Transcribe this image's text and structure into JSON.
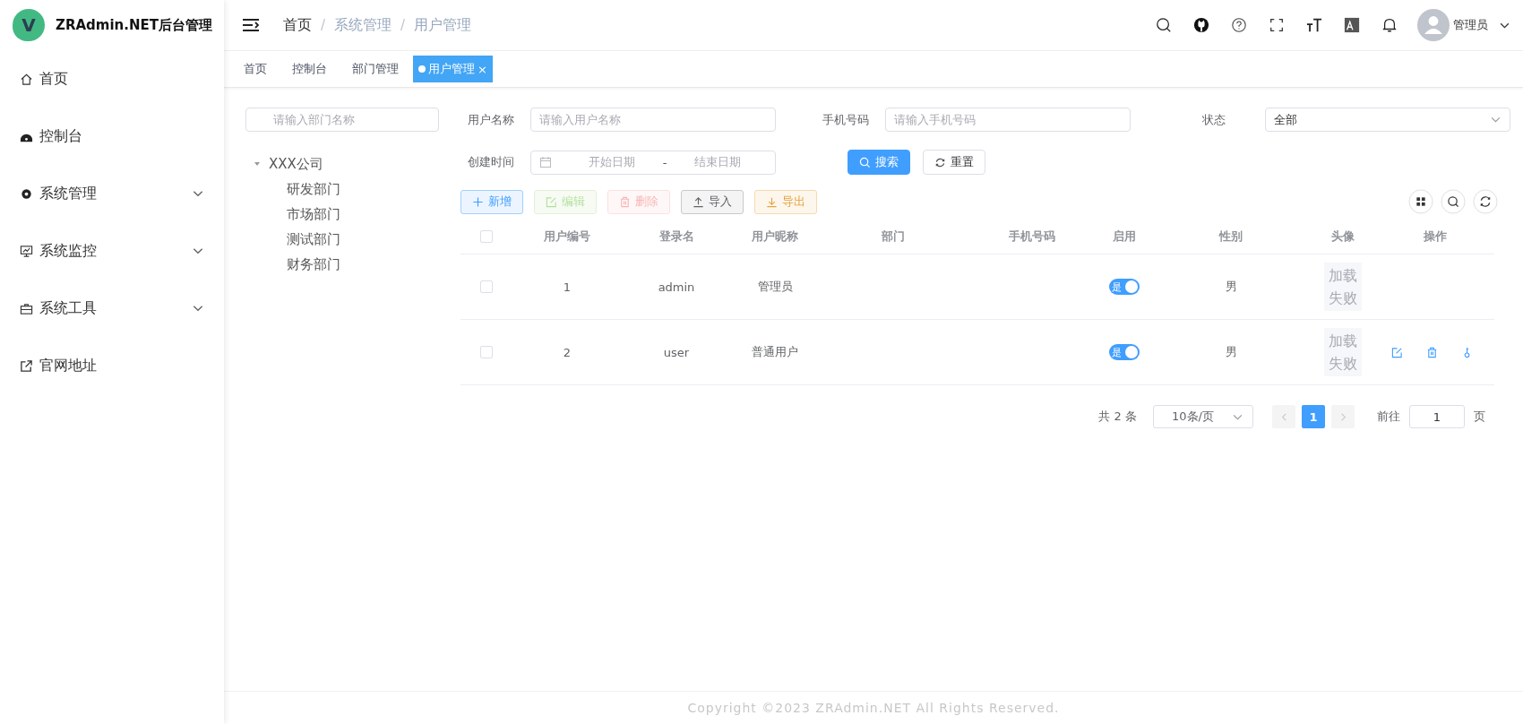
{
  "app": {
    "logo_letter": "V",
    "title": "ZRAdmin.NET后台管理"
  },
  "sidebar": {
    "items": [
      {
        "label": "首页",
        "kind": "link"
      },
      {
        "label": "控制台",
        "kind": "link"
      },
      {
        "label": "系统管理",
        "kind": "submenu",
        "expanded": false
      },
      {
        "label": "系统监控",
        "kind": "submenu",
        "expanded": false
      },
      {
        "label": "系统工具",
        "kind": "submenu",
        "expanded": false
      },
      {
        "label": "官网地址",
        "kind": "link"
      }
    ]
  },
  "header": {
    "separator": "/",
    "breadcrumb": [
      {
        "label": "首页",
        "current": false
      },
      {
        "label": "系统管理",
        "current": true
      },
      {
        "label": "用户管理",
        "current": true
      }
    ],
    "user_name": "管理员"
  },
  "tabs": [
    {
      "label": "首页",
      "selected": false
    },
    {
      "label": "控制台",
      "selected": false
    },
    {
      "label": "部门管理",
      "selected": false
    },
    {
      "label": "用户管理",
      "selected": true,
      "close": "×"
    }
  ],
  "dept_tree": {
    "placeholder": "请输入部门名称",
    "root": {
      "label": "XXX公司",
      "expanded": true,
      "children": [
        {
          "label": "研发部门"
        },
        {
          "label": "市场部门"
        },
        {
          "label": "测试部门"
        },
        {
          "label": "财务部门"
        }
      ]
    }
  },
  "filters": [
    {
      "kind": "text",
      "label": "用户名称",
      "placeholder": "请输入用户名称"
    },
    {
      "kind": "text",
      "label": "手机号码",
      "placeholder": "请输入手机号码"
    },
    {
      "kind": "select",
      "label": "状态",
      "value": "全部"
    },
    {
      "kind": "daterange",
      "label": "创建时间",
      "start_placeholder": "开始日期",
      "separator": "-",
      "end_placeholder": "结束日期"
    }
  ],
  "search_buttons": [
    {
      "label": "搜索",
      "kind": "primary"
    },
    {
      "label": "重置",
      "kind": "default"
    }
  ],
  "toolbar": [
    {
      "label": "新增",
      "kind": "primary",
      "disabled": false
    },
    {
      "label": "编辑",
      "kind": "success",
      "disabled": true
    },
    {
      "label": "删除",
      "kind": "danger",
      "disabled": true
    },
    {
      "label": "导入",
      "kind": "info",
      "disabled": false
    },
    {
      "label": "导出",
      "kind": "warning",
      "disabled": false
    }
  ],
  "table": {
    "all_checked": false,
    "columns": [
      "用户编号",
      "登录名",
      "用户昵称",
      "部门",
      "手机号码",
      "启用",
      "性别",
      "头像",
      "操作"
    ],
    "rows": [
      {
        "checked": false,
        "id": "1",
        "login": "admin",
        "nickname": "管理员",
        "enabled": true,
        "enabled_label": "是",
        "gender": "男",
        "avatar": "加载失败",
        "actions": false
      },
      {
        "checked": false,
        "id": "2",
        "login": "user",
        "nickname": "普通用户",
        "enabled": true,
        "enabled_label": "是",
        "gender": "男",
        "avatar": "加载失败",
        "actions": true
      }
    ]
  },
  "pagination": {
    "total": "共 2 条",
    "page_size": "10条/页",
    "pages": [
      {
        "label": "1",
        "selected": true
      }
    ],
    "prev_disabled": true,
    "next_disabled": true,
    "goto_label": "前往",
    "goto_value": "1",
    "goto_suffix": "页"
  },
  "footer": "Copyright ©2023 ZRAdmin.NET All Rights Reserved."
}
